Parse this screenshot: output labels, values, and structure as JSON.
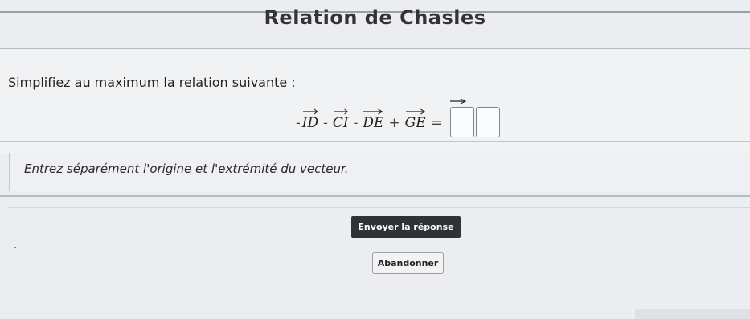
{
  "title": "Relation de Chasles",
  "instruction": "Simplifiez au maximum la relation suivante :",
  "equation": {
    "terms": [
      {
        "sign": "-",
        "vector": "ID"
      },
      {
        "sign": "-",
        "vector": "CI"
      },
      {
        "sign": "-",
        "vector": "DE"
      },
      {
        "sign": "+",
        "vector": "GE"
      }
    ],
    "equals": "="
  },
  "hint": "Entrez séparément l'origine et l'extrémité du vecteur.",
  "buttons": {
    "submit": "Envoyer la réponse",
    "abandon": "Abandonner"
  }
}
